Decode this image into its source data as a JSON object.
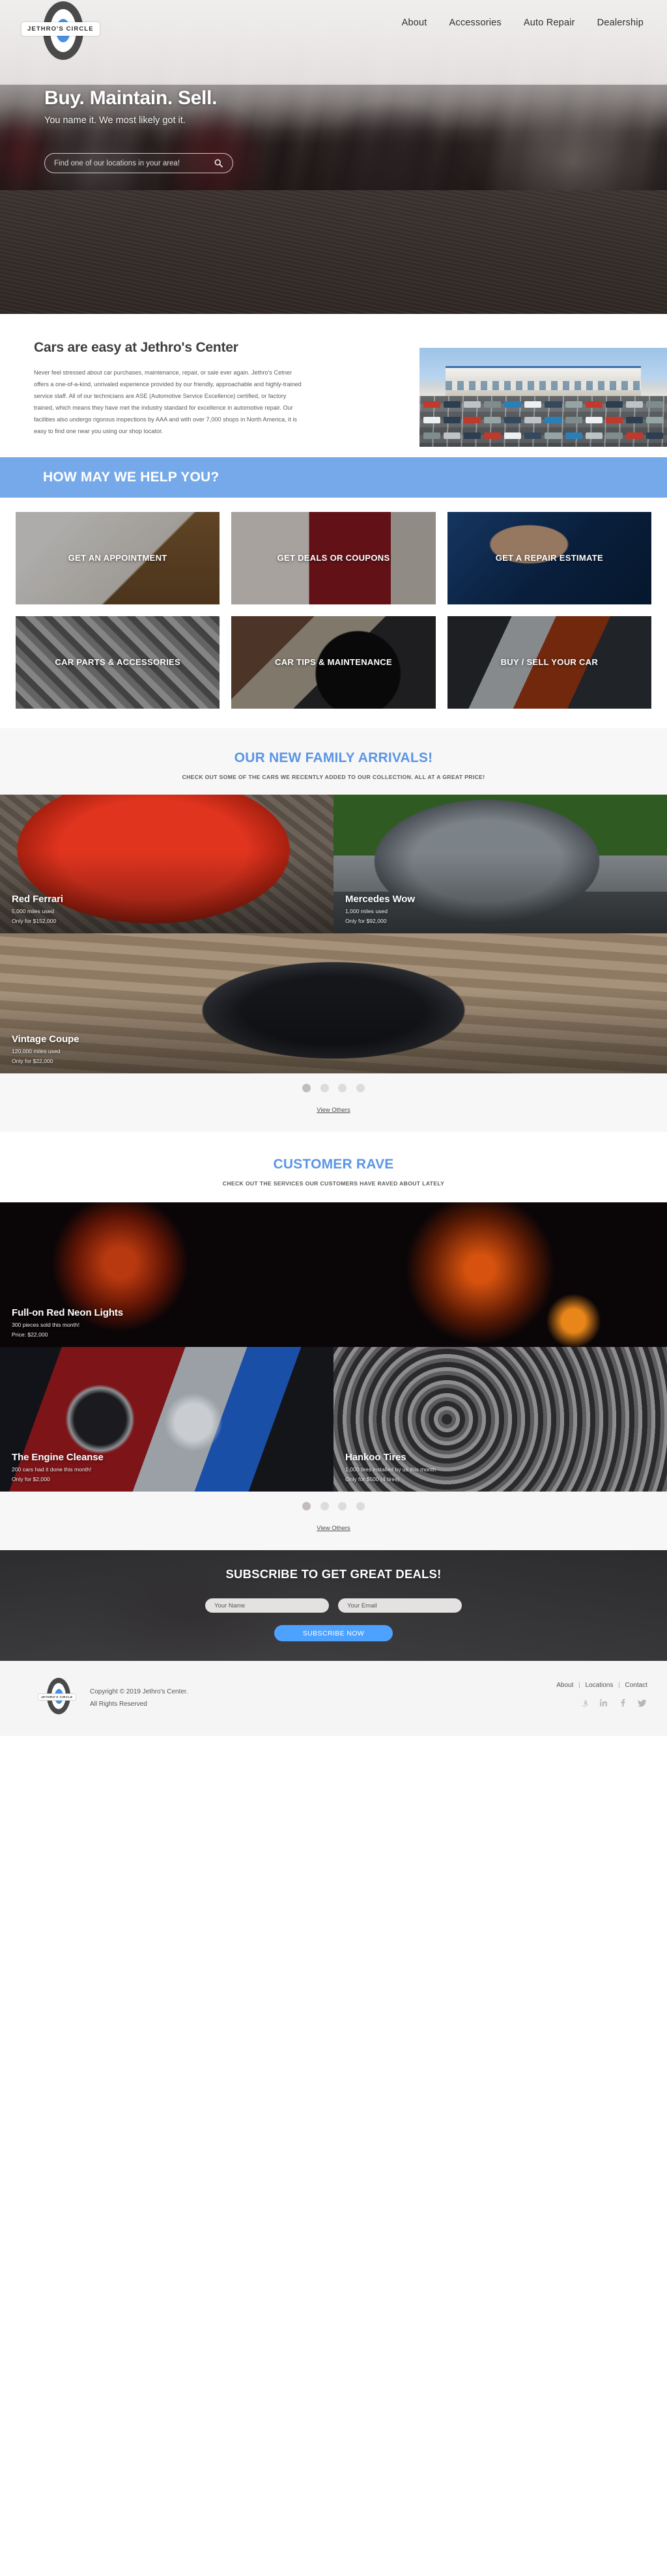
{
  "brand": {
    "name": "JETHRO'S CIRCLE",
    "accent_blue": "#4a90e2",
    "band_blue": "#76a9ea",
    "heading_blue": "#5b95e5"
  },
  "nav": {
    "items": [
      {
        "label": "About"
      },
      {
        "label": "Accessories"
      },
      {
        "label": "Auto Repair"
      },
      {
        "label": "Dealership"
      }
    ]
  },
  "hero": {
    "title": "Buy. Maintain. Sell.",
    "subtitle": "You name it. We most likely got it.",
    "search_placeholder": "Find one of our locations in your area!",
    "search_value": "",
    "search_icon": "search-icon"
  },
  "about": {
    "heading": "Cars are easy at Jethro's Center",
    "paragraph": "Never feel stressed about car purchases, maintenance, repair, or sale ever again. Jethro's Cetner offers a one-of-a-kind, unrivaled experience provided by our friendly, approachable and highly-trained service staff. All of our technicians are ASE (Automotive Service Excellence) certified, or factory trained, which means they have met the industry standard for excellence in automotive repair. Our facilities also undergo rigorous inspections by AAA and with over 7,000 shops in North America, it is easy to find one near you using our shop locator."
  },
  "help": {
    "heading": "HOW MAY WE HELP YOU?",
    "tiles": [
      {
        "label": "GET AN APPOINTMENT",
        "bg": "bg-calendar"
      },
      {
        "label": "GET DEALS OR COUPONS",
        "bg": "bg-coupons"
      },
      {
        "label": "GET A REPAIR ESTIMATE",
        "bg": "bg-repair"
      },
      {
        "label": "CAR PARTS & ACCESSORIES",
        "bg": "bg-parts"
      },
      {
        "label": "CAR TIPS & MAINTENANCE",
        "bg": "bg-tips"
      },
      {
        "label": "BUY / SELL YOUR CAR",
        "bg": "bg-sell"
      }
    ]
  },
  "arrivals": {
    "title": "OUR NEW FAMILY ARRIVALS!",
    "subtitle": "CHECK OUT SOME OF THE CARS WE RECENTLY ADDED TO OUR COLLECTION. ALL AT A GREAT PRICE!",
    "cars": [
      {
        "name": "Red Ferrari",
        "detail": "5,000 miles used",
        "price": "Only for $152,000",
        "bg": "bg-ferrari"
      },
      {
        "name": "Mercedes Wow",
        "detail": "1,000 miles used",
        "price": "Only for $92,000",
        "bg": "bg-merc"
      },
      {
        "name": "Vintage Coupe",
        "detail": "120,000 miles used",
        "price": "Only for $22,000",
        "bg": "bg-coupe"
      }
    ],
    "dots": 4,
    "active_dot": 0,
    "view_others": "View Others"
  },
  "rave": {
    "title": "CUSTOMER RAVE",
    "subtitle": "CHECK OUT THE SERVICES OUR CUSTOMERS HAVE RAVED ABOUT LATELY",
    "products": [
      {
        "name": "Full-on Red Neon Lights",
        "detail": "300 pieces sold this month!",
        "price": "Price: $22,000",
        "bg": "bg-neon"
      },
      {
        "name": "The Engine Cleanse",
        "detail": "200 cars had it done this month!",
        "price": "Only for $2,000",
        "bg": "bg-engine"
      },
      {
        "name": "Hankoo Tires",
        "detail": "1,000  tires installed by us this month",
        "price": "Only for $500 (4 tires)",
        "bg": "bg-tires"
      }
    ],
    "dots": 4,
    "active_dot": 0,
    "view_others": "View Others"
  },
  "subscribe": {
    "heading": "SUBSCRIBE TO GET GREAT DEALS!",
    "name_placeholder": "Your Name",
    "name_value": "",
    "email_placeholder": "Your Email",
    "email_value": "",
    "button_label": "SUBSCRIBE NOW"
  },
  "footer": {
    "copyright_line1": "Copyright © 2019 Jethro's Center.",
    "copyright_line2": "All Rights Reserved",
    "links": [
      {
        "label": "About"
      },
      {
        "label": "Locations"
      },
      {
        "label": "Contact"
      }
    ],
    "social": [
      {
        "name": "amazon-icon"
      },
      {
        "name": "linkedin-icon"
      },
      {
        "name": "facebook-icon"
      },
      {
        "name": "twitter-icon"
      }
    ]
  }
}
